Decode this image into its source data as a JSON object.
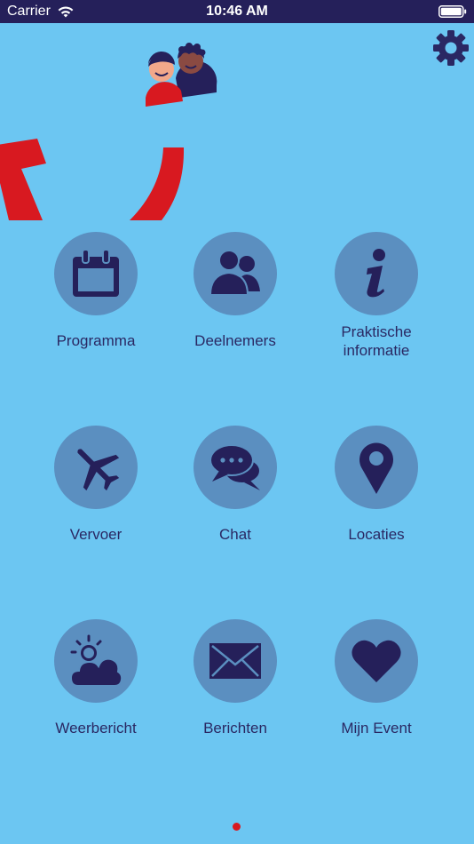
{
  "status_bar": {
    "carrier": "Carrier",
    "time": "10:46 AM"
  },
  "colors": {
    "background": "#6cc6f2",
    "status_bar": "#25205a",
    "icon_circle": "#5b8fc0",
    "icon": "#25205a",
    "label": "#2a2863",
    "accent_red": "#d81920"
  },
  "settings": {
    "icon": "gear-icon"
  },
  "menu": [
    {
      "label": "Programma",
      "icon": "calendar-icon"
    },
    {
      "label": "Deelnemers",
      "icon": "people-icon"
    },
    {
      "label": "Praktische informatie",
      "line1": "Praktische",
      "line2": "informatie",
      "icon": "info-icon"
    },
    {
      "label": "Vervoer",
      "icon": "airplane-icon"
    },
    {
      "label": "Chat",
      "icon": "chat-icon"
    },
    {
      "label": "Locaties",
      "icon": "map-pin-icon"
    },
    {
      "label": "Weerbericht",
      "icon": "weather-icon"
    },
    {
      "label": "Berichten",
      "icon": "envelope-icon"
    },
    {
      "label": "Mijn Event",
      "icon": "heart-icon"
    }
  ],
  "pager": {
    "current_page": 1,
    "page_count": 1
  }
}
